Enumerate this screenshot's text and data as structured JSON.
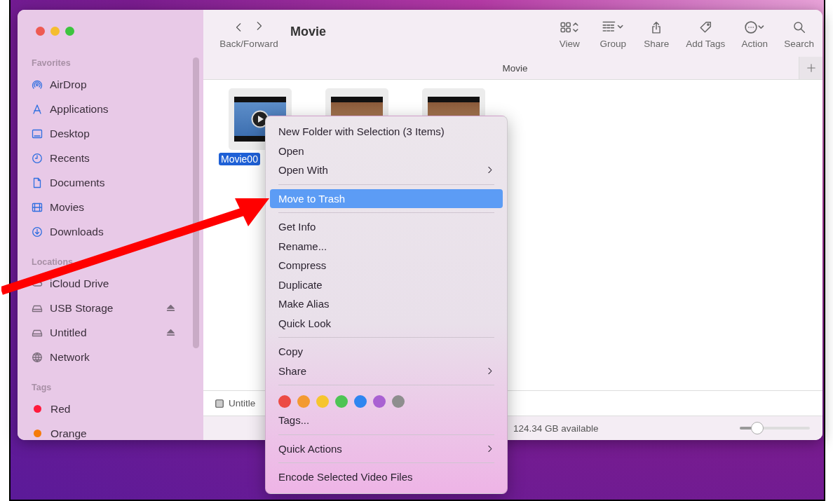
{
  "window": {
    "title": "Movie",
    "tab_title": "Movie"
  },
  "toolbar": {
    "nav_label": "Back/Forward",
    "buttons": [
      {
        "label": "View",
        "kind": "view"
      },
      {
        "label": "Group",
        "kind": "group"
      },
      {
        "label": "Share",
        "kind": "share"
      },
      {
        "label": "Add Tags",
        "kind": "tag"
      },
      {
        "label": "Action",
        "kind": "action"
      },
      {
        "label": "Search",
        "kind": "search"
      }
    ]
  },
  "sidebar": {
    "sections": [
      {
        "title": "Favorites",
        "items": [
          {
            "label": "AirDrop",
            "kind": "airdrop"
          },
          {
            "label": "Applications",
            "kind": "apps"
          },
          {
            "label": "Desktop",
            "kind": "desktop"
          },
          {
            "label": "Recents",
            "kind": "clock"
          },
          {
            "label": "Documents",
            "kind": "doc"
          },
          {
            "label": "Movies",
            "kind": "film"
          },
          {
            "label": "Downloads",
            "kind": "download"
          }
        ]
      },
      {
        "title": "Locations",
        "items": [
          {
            "label": "iCloud Drive",
            "kind": "cloud"
          },
          {
            "label": "USB Storage",
            "kind": "drive",
            "ejectable": true
          },
          {
            "label": "Untitled",
            "kind": "drive",
            "ejectable": true
          },
          {
            "label": "Network",
            "kind": "globe"
          }
        ]
      },
      {
        "title": "Tags",
        "items": [
          {
            "label": "Red",
            "kind": "tag",
            "color": "#ff1a3c"
          },
          {
            "label": "Orange",
            "kind": "tag",
            "color": "#f57b0a"
          }
        ]
      }
    ]
  },
  "files": [
    {
      "name": "Movie00",
      "selected": true,
      "kind": "play"
    },
    {
      "selected": true,
      "kind": "photo"
    },
    {
      "selected": true,
      "kind": "photo"
    }
  ],
  "path_bar": {
    "item": "Untitle"
  },
  "status_bar": {
    "text": "124.34 GB available",
    "zoom": {
      "level": 0.25
    }
  },
  "context_menu": {
    "items": [
      {
        "kind": "item",
        "label": "New Folder with Selection (3 Items)",
        "selected": false,
        "submenu": false
      },
      {
        "kind": "item",
        "label": "Open",
        "selected": false,
        "submenu": false
      },
      {
        "kind": "item",
        "label": "Open With",
        "selected": false,
        "submenu": true
      },
      {
        "kind": "separator"
      },
      {
        "kind": "item",
        "label": "Move to Trash",
        "selected": true,
        "submenu": false
      },
      {
        "kind": "separator"
      },
      {
        "kind": "item",
        "label": "Get Info",
        "selected": false,
        "submenu": false
      },
      {
        "kind": "item",
        "label": "Rename...",
        "selected": false,
        "submenu": false
      },
      {
        "kind": "item",
        "label": "Compress",
        "selected": false,
        "submenu": false
      },
      {
        "kind": "item",
        "label": "Duplicate",
        "selected": false,
        "submenu": false
      },
      {
        "kind": "item",
        "label": "Make Alias",
        "selected": false,
        "submenu": false
      },
      {
        "kind": "item",
        "label": "Quick Look",
        "selected": false,
        "submenu": false
      },
      {
        "kind": "separator"
      },
      {
        "kind": "item",
        "label": "Copy",
        "selected": false,
        "submenu": false
      },
      {
        "kind": "item",
        "label": "Share",
        "selected": false,
        "submenu": true
      },
      {
        "kind": "separator"
      },
      {
        "kind": "tags",
        "tags": [
          {
            "color": "#ec4b45"
          },
          {
            "color": "#f39a31"
          },
          {
            "color": "#f6c52e"
          },
          {
            "color": "#4dc454"
          },
          {
            "color": "#2f85f0"
          },
          {
            "color": "#a961d2"
          },
          {
            "color": "#8e8e8e"
          }
        ]
      },
      {
        "kind": "item",
        "label": "Tags...",
        "selected": false,
        "submenu": false
      },
      {
        "kind": "separator"
      },
      {
        "kind": "item",
        "label": "Quick Actions",
        "selected": false,
        "submenu": true
      },
      {
        "kind": "separator"
      },
      {
        "kind": "item",
        "label": "Encode Selected Video Files",
        "selected": false,
        "submenu": false
      }
    ]
  }
}
